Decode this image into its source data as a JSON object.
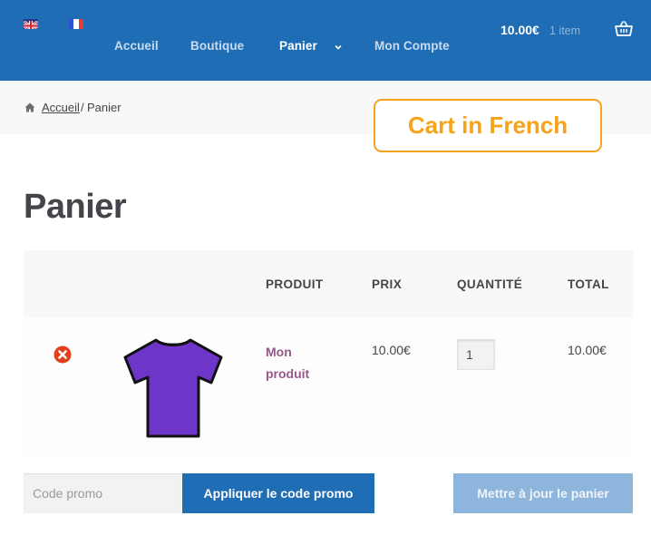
{
  "header": {
    "languages": [
      {
        "code": "en",
        "icon": "uk-flag-icon"
      },
      {
        "code": "fr",
        "icon": "france-flag-icon",
        "colors": [
          "#2f4fd1",
          "#ffffff",
          "#e63b3b"
        ]
      }
    ],
    "nav": [
      {
        "label": "Accueil",
        "active": false
      },
      {
        "label": "Boutique",
        "active": false
      },
      {
        "label": "Panier",
        "active": true,
        "has_submenu": true
      },
      {
        "label": "Mon Compte",
        "active": false
      }
    ],
    "cart_total": "10.00€",
    "cart_count": "1 item",
    "basket_icon": "basket-icon"
  },
  "breadcrumb": {
    "home_icon": "home-icon",
    "home": "Accueil",
    "separator": "/",
    "current": "Panier"
  },
  "callout": "Cart in French",
  "page_title": "Panier",
  "table": {
    "headers": {
      "product": "PRODUIT",
      "price": "PRIX",
      "quantity": "QUANTITÉ",
      "total": "TOTAL"
    },
    "rows": [
      {
        "remove_icon": "remove-icon",
        "image_icon": "tshirt-icon",
        "image_color": "#6e35c9",
        "product": "Mon produit",
        "price": "10.00€",
        "quantity": "1",
        "total": "10.00€"
      }
    ]
  },
  "actions": {
    "coupon_placeholder": "Code promo",
    "apply_label": "Appliquer le code promo",
    "update_label": "Mettre à jour le panier"
  },
  "colors": {
    "header_bg": "#1e6db5",
    "accent_orange": "#f7a21b",
    "product_link": "#96588a",
    "remove_red": "#e2401c",
    "update_disabled": "#8eb6dc"
  }
}
